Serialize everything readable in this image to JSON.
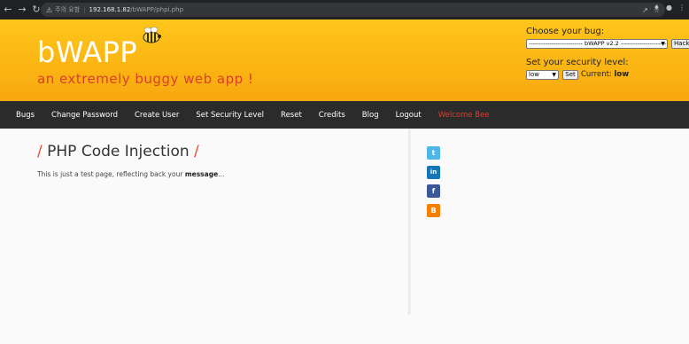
{
  "browser": {
    "security_warning": "주의 요함",
    "url_host": "192.168.1.82",
    "url_path": "/bWAPP/phpi.php"
  },
  "header": {
    "logo": "bWAPP",
    "tagline": "an extremely buggy web app !",
    "choose_bug_label": "Choose your bug:",
    "bug_selected": "-------------------------- bWAPP v2.2 ----------------------------",
    "hack_button": "Hack",
    "security_label": "Set your security level:",
    "security_selected": "low",
    "set_button": "Set",
    "current_label": "Current:",
    "current_value": "low"
  },
  "menu": {
    "items": [
      "Bugs",
      "Change Password",
      "Create User",
      "Set Security Level",
      "Reset",
      "Credits",
      "Blog",
      "Logout",
      "Welcome Bee"
    ]
  },
  "main": {
    "title": "PHP Code Injection",
    "message_prefix": "This is just a test page, reflecting back your",
    "message_bold": "message",
    "message_suffix": "..."
  },
  "social": {
    "twitter": "t",
    "linkedin": "in",
    "facebook": "f",
    "blogger": "B"
  },
  "colors": {
    "header_yellow": "#ffc61a",
    "menu_bg": "#2b2b2b",
    "accent_red": "#e53a2b"
  }
}
